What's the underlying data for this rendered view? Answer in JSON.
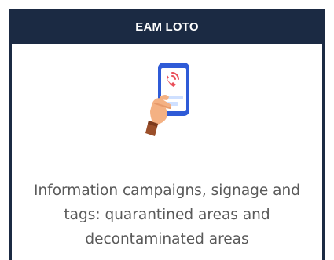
{
  "card": {
    "title": "EAM LOTO",
    "description": "Information campaigns, signage and tags: quarantined areas and decontaminated areas",
    "illustration_icon": "hand-holding-phone-icon"
  },
  "colors": {
    "header_background": "#1b2a43",
    "header_text": "#ffffff",
    "description_text": "#595959",
    "phone_frame": "#2f5bd7",
    "call_accent": "#e94e58"
  }
}
